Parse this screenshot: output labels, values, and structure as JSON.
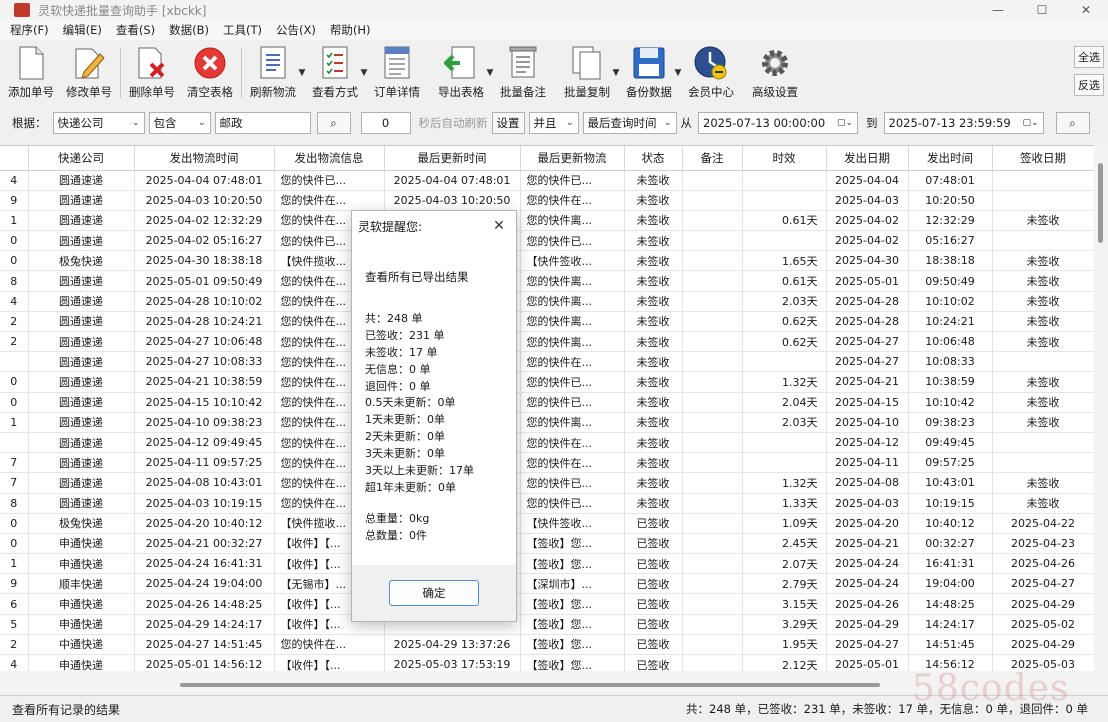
{
  "window": {
    "title": "灵软快递批量查询助手 [xbckk]",
    "controls": [
      "—",
      "☐",
      "✕"
    ]
  },
  "menu": [
    "程序(F)",
    "编辑(E)",
    "查看(S)",
    "数据(B)",
    "工具(T)",
    "公告(X)",
    "帮助(H)"
  ],
  "toolbar": {
    "add": "添加单号",
    "edit": "修改单号",
    "delete": "删除单号",
    "clear": "清空表格",
    "refresh": "刷新物流",
    "view_mode": "查看方式",
    "order_detail": "订单详情",
    "export": "导出表格",
    "batch_note": "批量备注",
    "batch_copy": "批量复制",
    "backup": "备份数据",
    "member": "会员中心",
    "advanced": "高级设置"
  },
  "side_buttons": {
    "select_all": "全选",
    "invert": "反选"
  },
  "filter": {
    "basis_label": "根据：",
    "company": "快递公司",
    "contains": "包含",
    "keyword": "邮政",
    "search_glyph": "⌕",
    "interval": "0",
    "auto_refresh": "秒后自动刷新",
    "settings": "设置",
    "range_mode": "并且",
    "time_field": "最后查询时间",
    "from_label": "从",
    "from": "2025-07-13 00:00:00",
    "to_label": "到",
    "to": "2025-07-13 23:59:59"
  },
  "table": {
    "columns": [
      "快递公司",
      "发出物流时间",
      "发出物流信息",
      "最后更新时间",
      "最后更新物流",
      "状态",
      "备注",
      "时效",
      "发出日期",
      "发出时间",
      "签收日期"
    ],
    "rows": [
      {
        "idx": "4",
        "company": "圆通速递",
        "send_time": "2025-04-04 07:48:01",
        "send_info": "您的快件已...",
        "update_time": "2025-04-04 07:48:01",
        "update_info": "您的快件已...",
        "status": "未签收",
        "note": "",
        "aging": "",
        "date": "2025-04-04",
        "time": "07:48:01",
        "sign": ""
      },
      {
        "idx": "9",
        "company": "圆通速递",
        "send_time": "2025-04-03 10:20:50",
        "send_info": "您的快件在...",
        "update_time": "2025-04-03 10:20:50",
        "update_info": "您的快件在...",
        "status": "未签收",
        "note": "",
        "aging": "",
        "date": "2025-04-03",
        "time": "10:20:50",
        "sign": ""
      },
      {
        "idx": "1",
        "company": "圆通速递",
        "send_time": "2025-04-02 12:32:29",
        "send_info": "您的快件在...",
        "update_time": "",
        "update_info": "您的快件离...",
        "status": "未签收",
        "note": "",
        "aging": "0.61天",
        "date": "2025-04-02",
        "time": "12:32:29",
        "sign": "未签收"
      },
      {
        "idx": "0",
        "company": "圆通速递",
        "send_time": "2025-04-02 05:16:27",
        "send_info": "您的快件已...",
        "update_time": "",
        "update_info": "您的快件已...",
        "status": "未签收",
        "note": "",
        "aging": "",
        "date": "2025-04-02",
        "time": "05:16:27",
        "sign": ""
      },
      {
        "idx": "0",
        "company": "极兔快递",
        "send_time": "2025-04-30 18:38:18",
        "send_info": "【快件揽收...",
        "update_time": "",
        "update_info": "【快件签收...",
        "status": "未签收",
        "note": "",
        "aging": "1.65天",
        "date": "2025-04-30",
        "time": "18:38:18",
        "sign": "未签收"
      },
      {
        "idx": "8",
        "company": "圆通速递",
        "send_time": "2025-05-01 09:50:49",
        "send_info": "您的快件在...",
        "update_time": "",
        "update_info": "您的快件离...",
        "status": "未签收",
        "note": "",
        "aging": "0.61天",
        "date": "2025-05-01",
        "time": "09:50:49",
        "sign": "未签收"
      },
      {
        "idx": "4",
        "company": "圆通速递",
        "send_time": "2025-04-28 10:10:02",
        "send_info": "您的快件在...",
        "update_time": "",
        "update_info": "您的快件离...",
        "status": "未签收",
        "note": "",
        "aging": "2.03天",
        "date": "2025-04-28",
        "time": "10:10:02",
        "sign": "未签收"
      },
      {
        "idx": "2",
        "company": "圆通速递",
        "send_time": "2025-04-28 10:24:21",
        "send_info": "您的快件在...",
        "update_time": "",
        "update_info": "您的快件离...",
        "status": "未签收",
        "note": "",
        "aging": "0.62天",
        "date": "2025-04-28",
        "time": "10:24:21",
        "sign": "未签收"
      },
      {
        "idx": "2",
        "company": "圆通速递",
        "send_time": "2025-04-27 10:06:48",
        "send_info": "您的快件在...",
        "update_time": "",
        "update_info": "您的快件离...",
        "status": "未签收",
        "note": "",
        "aging": "0.62天",
        "date": "2025-04-27",
        "time": "10:06:48",
        "sign": "未签收"
      },
      {
        "idx": "",
        "company": "圆通速递",
        "send_time": "2025-04-27 10:08:33",
        "send_info": "您的快件在...",
        "update_time": "",
        "update_info": "您的快件在...",
        "status": "未签收",
        "note": "",
        "aging": "",
        "date": "2025-04-27",
        "time": "10:08:33",
        "sign": ""
      },
      {
        "idx": "0",
        "company": "圆通速递",
        "send_time": "2025-04-21 10:38:59",
        "send_info": "您的快件在...",
        "update_time": "",
        "update_info": "您的快件已...",
        "status": "未签收",
        "note": "",
        "aging": "1.32天",
        "date": "2025-04-21",
        "time": "10:38:59",
        "sign": "未签收"
      },
      {
        "idx": "0",
        "company": "圆通速递",
        "send_time": "2025-04-15 10:10:42",
        "send_info": "您的快件在...",
        "update_time": "",
        "update_info": "您的快件已...",
        "status": "未签收",
        "note": "",
        "aging": "2.04天",
        "date": "2025-04-15",
        "time": "10:10:42",
        "sign": "未签收"
      },
      {
        "idx": "1",
        "company": "圆通速递",
        "send_time": "2025-04-10 09:38:23",
        "send_info": "您的快件在...",
        "update_time": "",
        "update_info": "您的快件离...",
        "status": "未签收",
        "note": "",
        "aging": "2.03天",
        "date": "2025-04-10",
        "time": "09:38:23",
        "sign": "未签收"
      },
      {
        "idx": "",
        "company": "圆通速递",
        "send_time": "2025-04-12 09:49:45",
        "send_info": "您的快件在...",
        "update_time": "",
        "update_info": "您的快件在...",
        "status": "未签收",
        "note": "",
        "aging": "",
        "date": "2025-04-12",
        "time": "09:49:45",
        "sign": ""
      },
      {
        "idx": "7",
        "company": "圆通速递",
        "send_time": "2025-04-11 09:57:25",
        "send_info": "您的快件在...",
        "update_time": "",
        "update_info": "您的快件在...",
        "status": "未签收",
        "note": "",
        "aging": "",
        "date": "2025-04-11",
        "time": "09:57:25",
        "sign": ""
      },
      {
        "idx": "7",
        "company": "圆通速递",
        "send_time": "2025-04-08 10:43:01",
        "send_info": "您的快件在...",
        "update_time": "",
        "update_info": "您的快件已...",
        "status": "未签收",
        "note": "",
        "aging": "1.32天",
        "date": "2025-04-08",
        "time": "10:43:01",
        "sign": "未签收"
      },
      {
        "idx": "8",
        "company": "圆通速递",
        "send_time": "2025-04-03 10:19:15",
        "send_info": "您的快件在...",
        "update_time": "",
        "update_info": "您的快件已...",
        "status": "未签收",
        "note": "",
        "aging": "1.33天",
        "date": "2025-04-03",
        "time": "10:19:15",
        "sign": "未签收"
      },
      {
        "idx": "0",
        "company": "极兔快递",
        "send_time": "2025-04-20 10:40:12",
        "send_info": "【快件揽收...",
        "update_time": "",
        "update_info": "【快件签收...",
        "status": "已签收",
        "note": "",
        "aging": "1.09天",
        "date": "2025-04-20",
        "time": "10:40:12",
        "sign": "2025-04-22"
      },
      {
        "idx": "0",
        "company": "申通快递",
        "send_time": "2025-04-21 00:32:27",
        "send_info": "【收件】【...",
        "update_time": "",
        "update_info": "【签收】您...",
        "status": "已签收",
        "note": "",
        "aging": "2.45天",
        "date": "2025-04-21",
        "time": "00:32:27",
        "sign": "2025-04-23"
      },
      {
        "idx": "1",
        "company": "申通快递",
        "send_time": "2025-04-24 16:41:31",
        "send_info": "【收件】【...",
        "update_time": "",
        "update_info": "【签收】您...",
        "status": "已签收",
        "note": "",
        "aging": "2.07天",
        "date": "2025-04-24",
        "time": "16:41:31",
        "sign": "2025-04-26"
      },
      {
        "idx": "9",
        "company": "顺丰快递",
        "send_time": "2025-04-24 19:04:00",
        "send_info": "【无锡市】...",
        "update_time": "",
        "update_info": "【深圳市】...",
        "status": "已签收",
        "note": "",
        "aging": "2.79天",
        "date": "2025-04-24",
        "time": "19:04:00",
        "sign": "2025-04-27"
      },
      {
        "idx": "6",
        "company": "申通快递",
        "send_time": "2025-04-26 14:48:25",
        "send_info": "【收件】【...",
        "update_time": "",
        "update_info": "【签收】您...",
        "status": "已签收",
        "note": "",
        "aging": "3.15天",
        "date": "2025-04-26",
        "time": "14:48:25",
        "sign": "2025-04-29"
      },
      {
        "idx": "5",
        "company": "申通快递",
        "send_time": "2025-04-29 14:24:17",
        "send_info": "【收件】【...",
        "update_time": "",
        "update_info": "【签收】您...",
        "status": "已签收",
        "note": "",
        "aging": "3.29天",
        "date": "2025-04-29",
        "time": "14:24:17",
        "sign": "2025-05-02"
      },
      {
        "idx": "2",
        "company": "中通快递",
        "send_time": "2025-04-27 14:51:45",
        "send_info": "您的快件在...",
        "update_time": "2025-04-29 13:37:26",
        "update_info": "【签收】您...",
        "status": "已签收",
        "note": "",
        "aging": "1.95天",
        "date": "2025-04-27",
        "time": "14:51:45",
        "sign": "2025-04-29"
      },
      {
        "idx": "4",
        "company": "申通快递",
        "send_time": "2025-05-01 14:56:12",
        "send_info": "【收件】【...",
        "update_time": "2025-05-03 17:53:19",
        "update_info": "【签收】您...",
        "status": "已签收",
        "note": "",
        "aging": "2.12天",
        "date": "2025-05-01",
        "time": "14:56:12",
        "sign": "2025-05-03"
      }
    ]
  },
  "dialog": {
    "title": "灵软提醒您:",
    "close": "✕",
    "heading": "查看所有已导出结果",
    "lines_a": [
      "共：248 单",
      "已签收：231 单",
      "未签收：17 单",
      "无信息：0 单",
      "退回件：0 单",
      "0.5天未更新：0单",
      "1天未更新：0单",
      "2天未更新：0单",
      "3天未更新：0单",
      "3天以上未更新：17单",
      "超1年未更新：0单"
    ],
    "lines_b": [
      "总重量：0kg",
      "总数量：0件"
    ],
    "ok": "确定"
  },
  "status": {
    "left": "查看所有记录的结果",
    "right": "共：248 单，已签收：231 单，未签收：17 单，无信息：0 单，退回件：0 单"
  },
  "watermark": "58codes"
}
